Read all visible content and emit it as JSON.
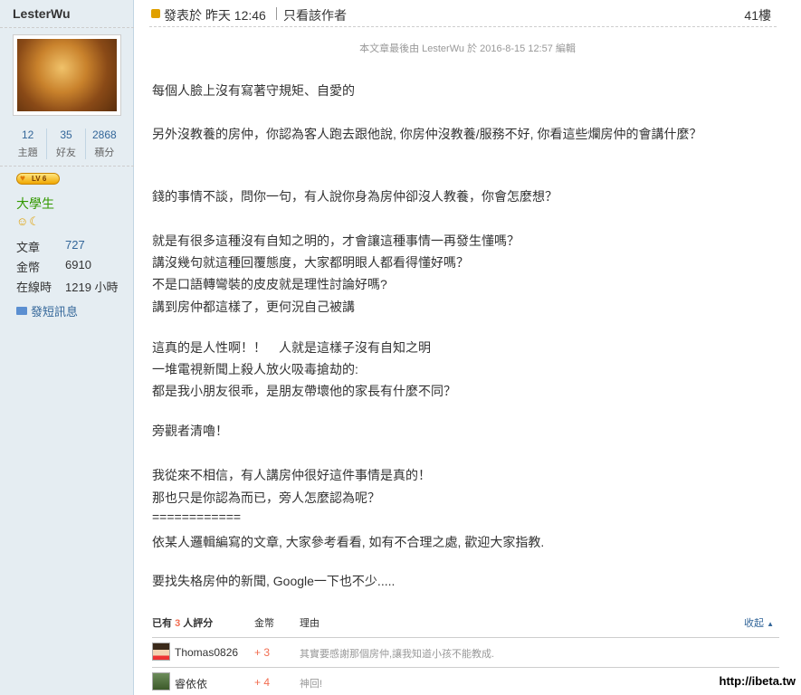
{
  "author": {
    "name": "LesterWu",
    "stats": [
      {
        "value": "12",
        "label": "主題"
      },
      {
        "value": "35",
        "label": "好友"
      },
      {
        "value": "2868",
        "label": "積分"
      }
    ],
    "level_badge": "LV 6",
    "rank": "大學生",
    "info": [
      {
        "label": "文章",
        "value": "727"
      },
      {
        "label": "金幣",
        "value": "6910"
      },
      {
        "label": "在線時",
        "value": "1219 小時"
      }
    ],
    "pm_label": "發短訊息"
  },
  "post": {
    "posted_at": "發表於 昨天 12:46",
    "only_author": "只看該作者",
    "floor": "41樓",
    "edited_note": "本文章最後由 LesterWu 於 2016-8-15 12:57 編輯",
    "lines": [
      "每個人臉上沒有寫著守規矩、自愛的",
      "另外沒教養的房仲，你認為客人跑去跟他說, 你房仲沒教養/服務不好, 你看這些爛房仲的會講什麼？",
      "錢的事情不談，問你一句，有人說你身為房仲卻沒人教養，你會怎麼想？",
      "就是有很多這種沒有自知之明的，才會讓這種事情一再發生懂嗎？",
      "講沒幾句就這種回覆態度，大家都明眼人都看得懂好嗎？",
      "不是口語轉彎裝的皮皮就是理性討論好嗎?",
      "講到房仲都這樣了，更何況自己被講",
      "這真的是人性啊！！　人就是這樣子沒有自知之明",
      "一堆電視新聞上殺人放火吸毒搶劫的:",
      "都是我小朋友很乖，是朋友帶壞他的家長有什麼不同？",
      "旁觀者清嚕！",
      "我從來不相信，有人講房仲很好這件事情是真的！",
      "那也只是你認為而已，旁人怎麼認為呢？",
      "============",
      "依某人邏輯編寫的文章, 大家參考看看, 如有不合理之處, 歡迎大家指教.",
      "要找失格房仲的新聞, Google一下也不少....."
    ]
  },
  "rating": {
    "count_prefix": "已有",
    "count": "3",
    "count_suffix": "人評分",
    "col_coin": "金幣",
    "col_reason": "理由",
    "collapse": "收起",
    "rows": [
      {
        "user": "Thomas0826",
        "points": "+ 3",
        "reason": "其實要感謝那個房仲,讓我知道小孩不能教成."
      },
      {
        "user": "睿依依",
        "points": "+ 4",
        "reason": "神回!"
      }
    ]
  },
  "watermark": "http://ibeta.tw"
}
